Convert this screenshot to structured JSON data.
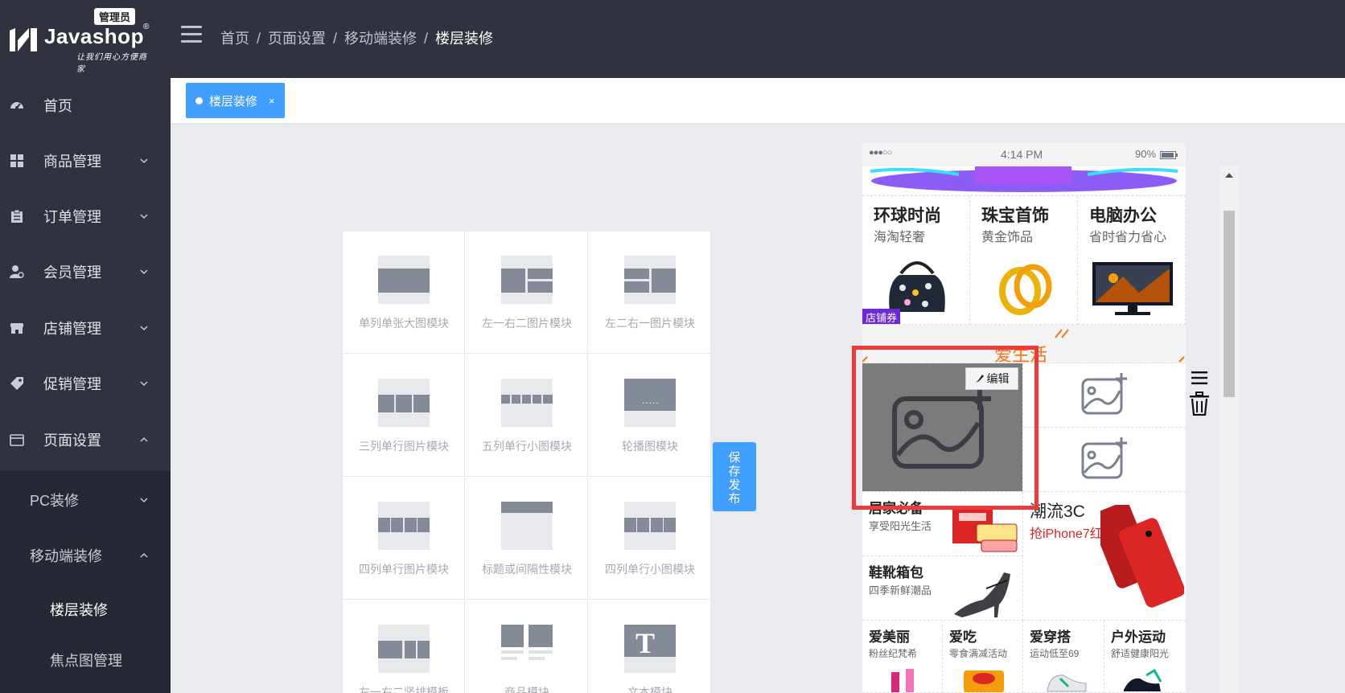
{
  "header": {
    "logo_badge": "管理员",
    "logo_name": "Javashop",
    "logo_reg": "®",
    "logo_slogan": "让我们用心方便商家",
    "breadcrumb": [
      "首页",
      "页面设置",
      "移动端装修",
      "楼层装修"
    ]
  },
  "sidebar": {
    "items": [
      {
        "label": "首页",
        "icon": "dashboard-icon"
      },
      {
        "label": "商品管理",
        "icon": "grid-icon"
      },
      {
        "label": "订单管理",
        "icon": "clipboard-icon"
      },
      {
        "label": "会员管理",
        "icon": "user-settings-icon"
      },
      {
        "label": "店铺管理",
        "icon": "store-icon"
      },
      {
        "label": "促销管理",
        "icon": "tag-icon"
      },
      {
        "label": "页面设置",
        "icon": "window-icon"
      }
    ],
    "sub_items": [
      {
        "label": "PC装修"
      },
      {
        "label": "移动端装修"
      }
    ],
    "leaf_items": [
      {
        "label": "楼层装修"
      },
      {
        "label": "焦点图管理"
      }
    ]
  },
  "tabs": {
    "active_label": "楼层装修",
    "close_glyph": "×"
  },
  "modules": [
    {
      "label": "单列单张大图模块"
    },
    {
      "label": "左一右二图片模块"
    },
    {
      "label": "左二右一图片模块"
    },
    {
      "label": "三列单行图片模块"
    },
    {
      "label": "五列单行小图模块"
    },
    {
      "label": "轮播图模块"
    },
    {
      "label": "四列单行图片模块"
    },
    {
      "label": "标题或间隔性模块"
    },
    {
      "label": "四列单行小图模块"
    },
    {
      "label": "左一右二竖排模板"
    },
    {
      "label": "商品模块"
    },
    {
      "label": "文本模块"
    }
  ],
  "carousel_dots": ".....",
  "text_module_glyph": "T",
  "save_button": [
    "保",
    "存",
    "发",
    "布"
  ],
  "phone": {
    "signal": "●●●○○",
    "time": "4:14 PM",
    "battery": "90%",
    "category_tiles": [
      {
        "title": "环球时尚",
        "subtitle": "海淘轻奢"
      },
      {
        "title": "珠宝首饰",
        "subtitle": "黄金饰品"
      },
      {
        "title": "电脑办公",
        "subtitle": "省时省力省心"
      }
    ],
    "coupon_tag": "店铺券",
    "banner_text": "爱生活",
    "edit_label": "编辑",
    "home_tile": {
      "title": "居家必备",
      "subtitle": "享受阳光生活"
    },
    "digital_tile": {
      "title": "潮流3C",
      "subtitle": "抢iPhone7红"
    },
    "shoes_tile": {
      "title": "鞋靴箱包",
      "subtitle": "四季新鲜潮品"
    },
    "small_tiles": [
      {
        "title": "爱美丽",
        "subtitle": "粉丝纪梵希"
      },
      {
        "title": "爱吃",
        "subtitle": "零食满减活动"
      },
      {
        "title": "爱穿搭",
        "subtitle": "运动低至69"
      },
      {
        "title": "户外运动",
        "subtitle": "舒适健康阳光"
      }
    ]
  },
  "colors": {
    "sidebar_bg": "#30323f",
    "accent": "#409eff",
    "highlight": "#f03a3a"
  }
}
